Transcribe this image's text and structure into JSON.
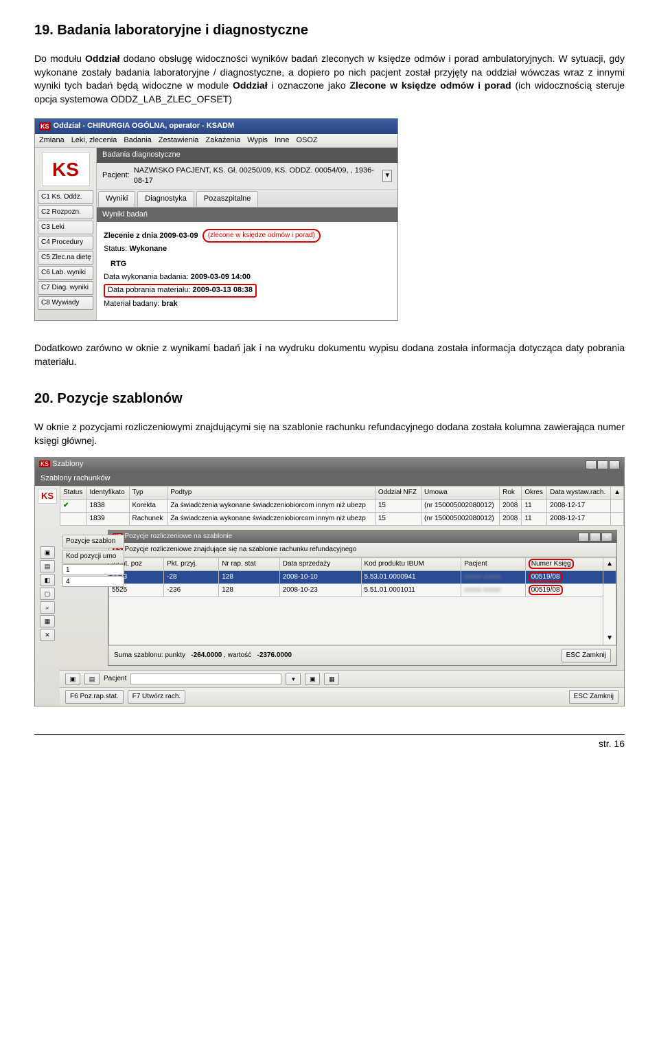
{
  "doc": {
    "h1": "19. Badania laboratoryjne i diagnostyczne",
    "p1a": "Do modułu ",
    "p1b": "Oddział",
    "p1c": " dodano obsługę widoczności wyników badań zleconych w księdze odmów i porad ambulatoryjnych. W sytuacji, gdy wykonane zostały badania laboratoryjne / diagnostyczne, a dopiero po nich pacjent został przyjęty na oddział wówczas wraz z innymi wyniki tych badań będą widoczne w module ",
    "p1d": "Oddział",
    "p1e": " i oznaczone jako ",
    "p1f": "Zlecone w księdze odmów i porad",
    "p1g": " (ich widocznością steruje opcja systemowa ODDZ_LAB_ZLEC_OFSET)",
    "p2": "Dodatkowo zarówno w oknie z wynikami badań jak i na wydruku dokumentu wypisu dodana została informacja dotycząca daty pobrania materiału.",
    "h2": "20. Pozycje szablonów",
    "p3": "W oknie z pozycjami rozliczeniowymi znajdującymi się na szablonie rachunku refundacyjnego dodana została kolumna zawierająca numer księgi głównej.",
    "footer": "str. 16"
  },
  "app1": {
    "title": "Oddział - CHIRURGIA OGÓLNA,  operator - KSADM",
    "menu": [
      "Zmiana",
      "Leki, zlecenia",
      "Badania",
      "Zestawienia",
      "Zakażenia",
      "Wypis",
      "Inne",
      "OSOZ"
    ],
    "sidebar": [
      "C1 Ks. Oddz.",
      "C2 Rozpozn.",
      "C3 Leki",
      "C4 Procedury",
      "C5 Zlec.na dietę",
      "C6 Lab. wyniki",
      "C7 Diag. wyniki",
      "C8 Wywiady"
    ],
    "section": "Badania diagnostyczne",
    "pacjent_label": "Pacjent:",
    "pacjent_value": "NAZWISKO PACJENT, KS. Gł. 00250/09, KS. ODDZ. 00054/09, , 1936-08-17",
    "tabs": [
      "Wyniki",
      "Diagnostyka",
      "Pozaszpitalne"
    ],
    "subsection": "Wyniki badań",
    "zlecenie_label": "Zlecenie z dnia",
    "zlecenie_date": "2009-03-09",
    "zlecenie_badge": "(zlecone w księdze odmów i porad)",
    "status_label": "Status:",
    "status_value": "Wykonane",
    "rtg": "RTG",
    "data_wyk_label": "Data wykonania badania:",
    "data_wyk_value": "2009-03-09 14:00",
    "data_pob_label": "Data pobrania materiału:",
    "data_pob_value": "2009-03-13 08:38",
    "material_label": "Materiał badany:",
    "material_value": "brak"
  },
  "app2": {
    "title": "Szablony",
    "subtitle": "Szablony rachunków",
    "cols": [
      "Status",
      "Identyfikato",
      "Typ",
      "Podtyp",
      "Oddział NFZ",
      "Umowa",
      "Rok",
      "Okres",
      "Data wystaw.rach."
    ],
    "rows": [
      {
        "status": "✔",
        "id": "1838",
        "typ": "Korekta",
        "podtyp": "Za świadczenia wykonane świadczeniobiorcom innym niż ubezp",
        "nfz": "15",
        "umowa": "(nr 150005002080012)",
        "rok": "2008",
        "okres": "11",
        "data": "2008-12-17"
      },
      {
        "status": "",
        "id": "1839",
        "typ": "Rachunek",
        "podtyp": "Za świadczenia wykonane świadczeniobiorcom innym niż ubezp",
        "nfz": "15",
        "umowa": "(nr 150005002080012)",
        "rok": "2008",
        "okres": "11",
        "data": "2008-12-17"
      }
    ],
    "side": {
      "lbl1": "Pozycje szablon",
      "lbl2": "Kod pozycji umo",
      "v1": "1",
      "v2": "4"
    },
    "inner": {
      "title": "Pozycje rozliczeniowe na szablonie",
      "sub": "Pozycje rozliczeniowe znajdujące się na szablonie rachunku refundacyjnego",
      "cols": [
        "Ident. poz",
        "Pkt. przyj.",
        "Nr rap. stat",
        "Data sprzedaży",
        "Kod produktu IBUM",
        "Pacjent",
        "Numer Księg"
      ],
      "rows": [
        {
          "id": "5523",
          "pkt": "-28",
          "nr": "128",
          "data": "2008-10-10",
          "kod": "5.53.01.0000941",
          "pac": "blur",
          "num": "00519/08"
        },
        {
          "id": "5525",
          "pkt": "-236",
          "nr": "128",
          "data": "2008-10-23",
          "kod": "5.51.01.0001011",
          "pac": "blur",
          "num": "00519/08"
        }
      ],
      "suma_label": "Suma szablonu:  punkty",
      "suma_pkt": "-264.0000",
      "wartosc_label": ", wartość",
      "wartosc": "-2376.0000",
      "esc": "ESC Zamknij"
    },
    "footer_left": "F6 Poz.rap.stat.",
    "footer_mid": "F7 Utwórz rach.",
    "pacjent_lbl": "Pacjent",
    "esc": "ESC Zamknij"
  }
}
